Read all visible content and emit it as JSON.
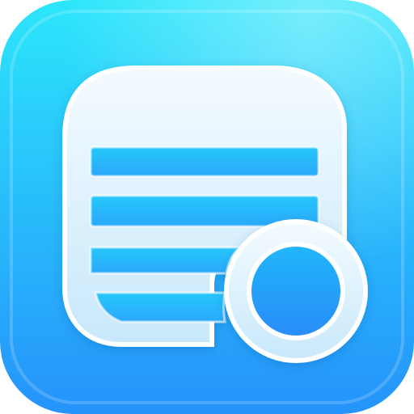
{
  "app_icon": {
    "icon": "search-list-icon",
    "colors": {
      "tile_top": "#2ce6fb",
      "tile_bottom": "#2593fb",
      "glyph_light": "#f4fbff",
      "glyph_dark": "#c8e8fb",
      "glyph_outline": "#ffffff",
      "lens_fill_top": "#1fb7fb",
      "lens_fill_bottom": "#2a8bf8"
    }
  }
}
